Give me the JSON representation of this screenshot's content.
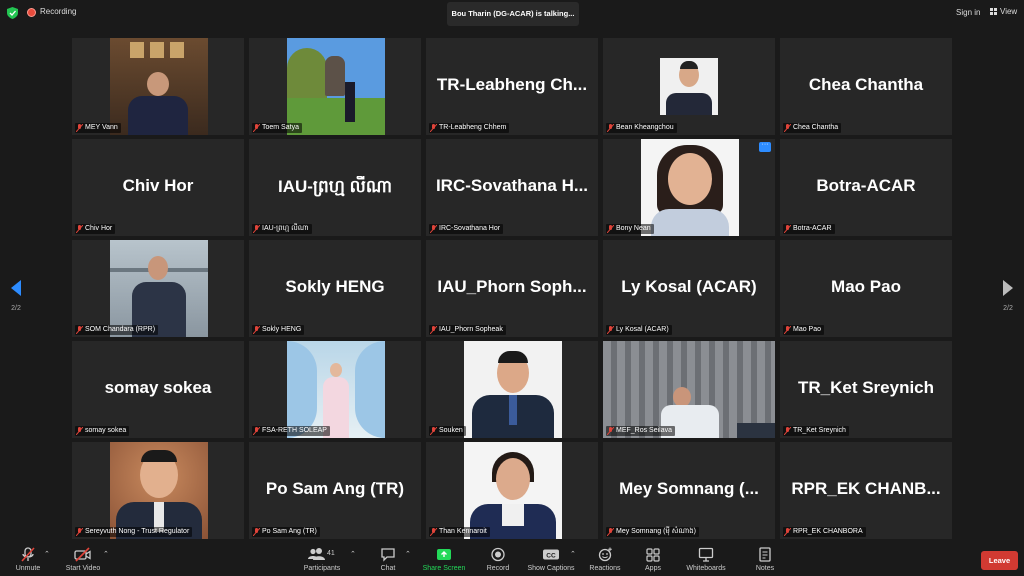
{
  "topbar": {
    "recording_label": "Recording",
    "talking_text": "Bou Tharin (DG-ACAR) is talking...",
    "sign_in": "Sign in",
    "view": "View"
  },
  "pagination": {
    "left": "2/2",
    "right": "2/2"
  },
  "tiles": [
    {
      "big": "",
      "label": "MEY Vann"
    },
    {
      "big": "",
      "label": "Toem Satya"
    },
    {
      "big": "TR-Leabheng  Ch...",
      "label": "TR-Leabheng Chhem"
    },
    {
      "big": "",
      "label": "Bean Kheangchou"
    },
    {
      "big": "Chea Chantha",
      "label": "Chea Chantha"
    },
    {
      "big": "Chiv Hor",
      "label": "Chiv Hor"
    },
    {
      "big": "IAU-ព្រហ្ម លីណា",
      "label": "IAU-ព្រហ្ម លីណា"
    },
    {
      "big": "IRC-Sovathana  H...",
      "label": "IRC-Sovathana Hor"
    },
    {
      "big": "",
      "label": "Bony Nean"
    },
    {
      "big": "Botra-ACAR",
      "label": "Botra-ACAR"
    },
    {
      "big": "",
      "label": "SOM Chandara (RPR)"
    },
    {
      "big": "Sokly HENG",
      "label": "Sokly HENG"
    },
    {
      "big": "IAU_Phorn  Soph...",
      "label": "IAU_Phorn Sopheak"
    },
    {
      "big": "Ly Kosal (ACAR)",
      "label": "Ly Kosal (ACAR)"
    },
    {
      "big": "Mao Pao",
      "label": "Mao Pao"
    },
    {
      "big": "somay sokea",
      "label": "somay sokea"
    },
    {
      "big": "",
      "label": "FSA-RETH SOLEAP"
    },
    {
      "big": "",
      "label": "Souken"
    },
    {
      "big": "",
      "label": "MEF_Ros Seilava"
    },
    {
      "big": "TR_Ket Sreynich",
      "label": "TR_Ket Sreynich"
    },
    {
      "big": "",
      "label": "Sereyvuth Nong - Trust Regulator"
    },
    {
      "big": "Po Sam Ang (TR)",
      "label": "Po Sam Ang (TR)"
    },
    {
      "big": "",
      "label": "Than Kennaroit"
    },
    {
      "big": "Mey  Somnang  (...",
      "label": "Mey Somnang (ម៉ី សំណាង)"
    },
    {
      "big": "RPR_EK  CHANB...",
      "label": "RPR_EK CHANBORA"
    }
  ],
  "toolbar": {
    "unmute": "Unmute",
    "start_video": "Start Video",
    "participants": "Participants",
    "participants_count": "41",
    "chat": "Chat",
    "share_screen": "Share Screen",
    "record": "Record",
    "show_captions": "Show Captions",
    "cc": "CC",
    "reactions": "Reactions",
    "apps": "Apps",
    "whiteboards": "Whiteboards",
    "notes": "Notes",
    "leave": "Leave"
  },
  "colors": {
    "background": "#1a1a1a",
    "tile": "#272727",
    "accent_blue": "#2d8cff",
    "share_green": "#23d959",
    "leave_red": "#d13a32",
    "mic_off_red": "#e0443a"
  }
}
